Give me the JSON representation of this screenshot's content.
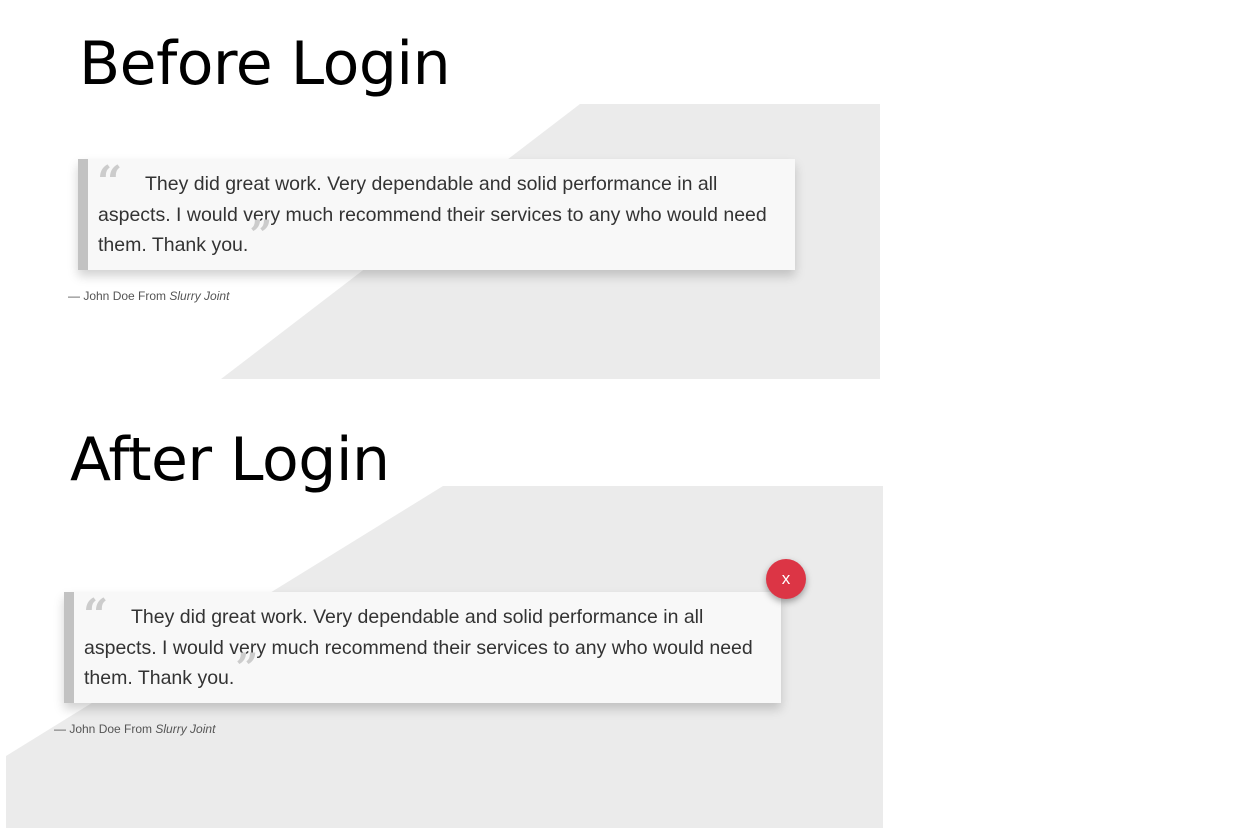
{
  "sections": [
    {
      "heading": "Before Login",
      "testimonial": {
        "open_quote": "“",
        "text": "They did great work. Very dependable and solid performance in all aspects. I would very much recommend their services to any who would need them. Thank you.",
        "close_quote": "”",
        "attribution_prefix": "— John Doe From",
        "company": "Slurry Joint"
      }
    },
    {
      "heading": "After Login",
      "testimonial": {
        "open_quote": "“",
        "text": "They did great work. Very dependable and solid performance in all aspects. I would very much recommend their services to any who would need them. Thank you.",
        "close_quote": "”",
        "attribution_prefix": "— John Doe From",
        "company": "Slurry Joint"
      },
      "close_button_label": "x"
    }
  ],
  "colors": {
    "panel_background": "#ebebeb",
    "card_background": "#f8f8f8",
    "card_border": "#c2c2c2",
    "quote_marks": "#cccccc",
    "close_button": "#dc3545"
  }
}
